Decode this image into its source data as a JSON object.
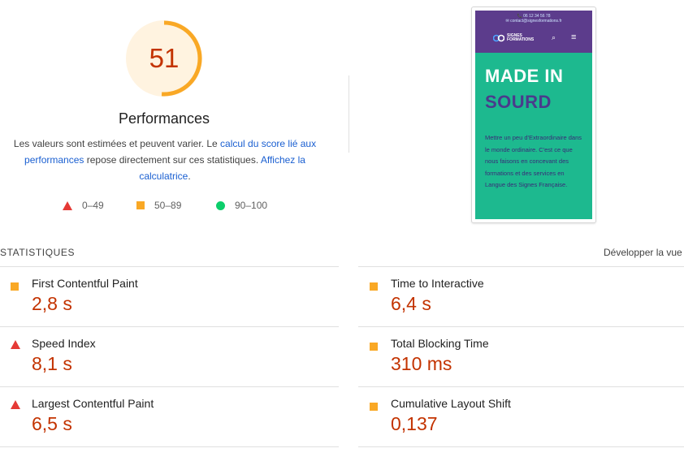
{
  "score": {
    "value": "51",
    "fraction": 0.51,
    "color": "#c33300",
    "arc_color": "#f9a825",
    "bg_color": "#fff3e0"
  },
  "performance": {
    "title": "Performances",
    "desc_part1": "Les valeurs sont estimées et peuvent varier. Le ",
    "link1": "calcul du score lié aux performances",
    "desc_part2": " repose directement sur ces statistiques. ",
    "link2": "Affichez la calculatrice",
    "desc_part3": "."
  },
  "legend": [
    {
      "icon": "triangle-red-icon",
      "label": "0–49",
      "color": "#e53935"
    },
    {
      "icon": "square-orange-icon",
      "label": "50–89",
      "color": "#f9a825"
    },
    {
      "icon": "circle-green-icon",
      "label": "90–100",
      "color": "#0cce6b"
    }
  ],
  "screenshot": {
    "contact_line1": "📞 06 12 34 56 78",
    "contact_line2": "✉ contact@signesformations.fr",
    "logo_text_1": "SIGNES",
    "logo_text_2": "FORMATIONS",
    "heading_1": "MADE IN",
    "heading_2": "SOURD",
    "paragraph": "Mettre un peu d'Extraordinaire dans le monde ordinaire. C'est ce que nous faisons en concevant des formations et des services en Langue des Signes Française."
  },
  "stats": {
    "title": "STATISTIQUES",
    "expand_label": "Développer la vue"
  },
  "metrics": [
    {
      "name": "First Contentful Paint",
      "value": "2,8 s",
      "rating": "average",
      "icon": "square-orange-icon",
      "color": "#c33300"
    },
    {
      "name": "Time to Interactive",
      "value": "6,4 s",
      "rating": "average",
      "icon": "square-orange-icon",
      "color": "#c33300"
    },
    {
      "name": "Speed Index",
      "value": "8,1 s",
      "rating": "fail",
      "icon": "triangle-red-icon",
      "color": "#c33300"
    },
    {
      "name": "Total Blocking Time",
      "value": "310 ms",
      "rating": "average",
      "icon": "square-orange-icon",
      "color": "#c33300"
    },
    {
      "name": "Largest Contentful Paint",
      "value": "6,5 s",
      "rating": "fail",
      "icon": "triangle-red-icon",
      "color": "#c33300"
    },
    {
      "name": "Cumulative Layout Shift",
      "value": "0,137",
      "rating": "average",
      "icon": "square-orange-icon",
      "color": "#c33300"
    }
  ]
}
